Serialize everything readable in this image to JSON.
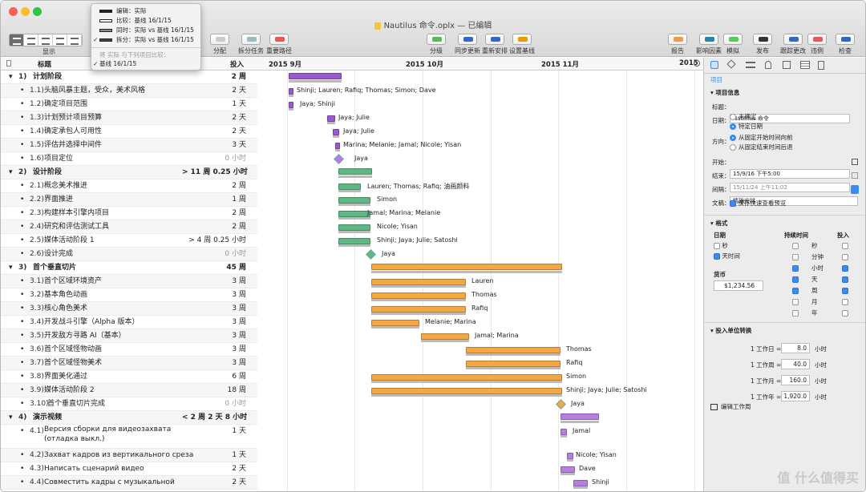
{
  "window": {
    "title": "Nautilus 命令.oplx — 已编辑",
    "title_prefix": "",
    "colors": {
      "close": "#fc5f57",
      "min": "#fdbc2e",
      "max": "#28c840"
    }
  },
  "toolbar": {
    "left_labels": [
      "显示"
    ],
    "items": [
      {
        "label": "分配",
        "icon": "person-icon"
      },
      {
        "label": "拆分任务",
        "icon": "split-icon"
      },
      {
        "label": "重要路径",
        "icon": "path-icon"
      },
      {
        "label": "分级",
        "icon": "level-icon"
      },
      {
        "label": "同步更新",
        "icon": "sync-icon"
      },
      {
        "label": "重新安排",
        "icon": "reschedule-icon"
      },
      {
        "label": "设置基线",
        "icon": "camera-icon"
      },
      {
        "label": "报告",
        "icon": "report-icon"
      },
      {
        "label": "影响因素",
        "icon": "influence-icon"
      },
      {
        "label": "模拟",
        "icon": "simulate-icon"
      },
      {
        "label": "发布",
        "icon": "cloud-icon"
      },
      {
        "label": "跟踪更改",
        "icon": "track-icon"
      },
      {
        "label": "违例",
        "icon": "violation-icon"
      },
      {
        "label": "检查",
        "icon": "inspect-icon"
      }
    ]
  },
  "popup": {
    "items": [
      "编辑：实际",
      "比较：基线 16/1/15",
      "同时：实际 vs 基线 16/1/15",
      "拆分：实际 vs 基线 16/1/15"
    ],
    "selected": 3,
    "section": "将 实际 与下列项目比较：",
    "baseline": "基线 16/1/15"
  },
  "columns": {
    "title": "标题",
    "effort": "投入"
  },
  "gantt_months": [
    "2015 9月",
    "2015 10月",
    "2015 11月",
    "2015"
  ],
  "rows": [
    {
      "num": "1)",
      "title": "计划阶段",
      "dur": "2 周",
      "group": true,
      "res": ""
    },
    {
      "num": "1.1)",
      "title": "头脑风暴主题，受众，美术风格",
      "dur": "2 天",
      "res": "Shinji; Lauren; Rafiq; Thomas; Simon; Dave"
    },
    {
      "num": "1.2)",
      "title": "确定项目范围",
      "dur": "1 天",
      "res": "Jaya; Shinji"
    },
    {
      "num": "1.3)",
      "title": "计划预计项目预算",
      "dur": "2 天",
      "res": "Jaya; Julie"
    },
    {
      "num": "1.4)",
      "title": "确定承包人可用性",
      "dur": "2 天",
      "res": "Jaya; Julie"
    },
    {
      "num": "1.5)",
      "title": "评估并选择中间件",
      "dur": "3 天",
      "res": "Marina; Melanie; Jamal; Nicole; Yisan"
    },
    {
      "num": "1.6)",
      "title": "项目定位",
      "dur": "0 小时",
      "res": "Jaya"
    },
    {
      "num": "2)",
      "title": "设计阶段",
      "dur": "> 11 周 0.25 小时",
      "group": true,
      "res": ""
    },
    {
      "num": "2.1)",
      "title": "概念美术推进",
      "dur": "2 周",
      "res": "Lauren; Thomas; Rafiq; 油画颜料"
    },
    {
      "num": "2.2)",
      "title": "界面推进",
      "dur": "1 周",
      "res": "Simon"
    },
    {
      "num": "2.3)",
      "title": "构建样本引擎内项目",
      "dur": "2 周",
      "res": "Jamal; Marina; Melanie"
    },
    {
      "num": "2.4)",
      "title": "研究和评估测试工具",
      "dur": "2 周",
      "res": "Nicole; Yisan"
    },
    {
      "num": "2.5)",
      "title": "媒体活动阶段 1",
      "dur": "> 4 周 0.25 小时",
      "res": "Shinji; Jaya; Julie; Satoshi"
    },
    {
      "num": "2.6)",
      "title": "设计完成",
      "dur": "0 小时",
      "res": "Jaya"
    },
    {
      "num": "3)",
      "title": "首个垂直切片",
      "dur": "45 周",
      "group": true,
      "res": ""
    },
    {
      "num": "3.1)",
      "title": "首个区域环境资产",
      "dur": "3 周",
      "res": "Lauren"
    },
    {
      "num": "3.2)",
      "title": "基本角色动画",
      "dur": "3 周",
      "res": "Thomas"
    },
    {
      "num": "3.3)",
      "title": "核心角色美术",
      "dur": "3 周",
      "res": "Rafiq"
    },
    {
      "num": "3.4)",
      "title": "开发战斗引擎（Alpha 版本）",
      "dur": "3 周",
      "res": "Melanie; Marina"
    },
    {
      "num": "3.5)",
      "title": "开发敌方寻路 AI（基本）",
      "dur": "3 周",
      "res": "Jamal; Marina"
    },
    {
      "num": "3.6)",
      "title": "首个区域怪物动画",
      "dur": "3 周",
      "res": "Thomas"
    },
    {
      "num": "3.7)",
      "title": "首个区域怪物美术",
      "dur": "3 周",
      "res": "Rafiq"
    },
    {
      "num": "3.8)",
      "title": "界面美化通过",
      "dur": "6 周",
      "res": "Simon"
    },
    {
      "num": "3.9)",
      "title": "媒体活动阶段 2",
      "dur": "18 周",
      "res": "Shinji; Jaya; Julie; Satoshi"
    },
    {
      "num": "3.10)",
      "title": "首个垂直切片完成",
      "dur": "0 小时",
      "res": "Jaya"
    },
    {
      "num": "4)",
      "title": "演示视频",
      "dur": "< 2 周 2 天 8 小时",
      "group": true,
      "res": ""
    },
    {
      "num": "4.1)",
      "title": "Версия сборки для видеозахвата (отладка выкл.)",
      "dur": "1 天",
      "res": "Jamal"
    },
    {
      "num": "4.2)",
      "title": "Захват кадров из вертикального среза",
      "dur": "1 天",
      "res": "Nicole; Yisan"
    },
    {
      "num": "4.3)",
      "title": "Написать сценарий видео",
      "dur": "2 天",
      "res": "Dave"
    },
    {
      "num": "4.4)",
      "title": "Совместить кадры с музыкальной",
      "dur": "2 天",
      "res": "Shinji"
    }
  ],
  "sidebar": {
    "tab_label": "项目",
    "info_title": "项目信息",
    "title_label": "标题：",
    "title_value": "Nautilus 命令",
    "date_label": "日期：",
    "date_opt1": "未确定",
    "date_opt2": "特定日期",
    "dir_label": "方向：",
    "dir_opt1": "从固定开始时间向前",
    "dir_opt2": "从固定结束时间后退",
    "start_label": "开始：",
    "start_value": "15/9/16 下午5:00",
    "end_label": "结束：",
    "end_value": "15/11/24 上午11:02",
    "gran_label": "间隔：",
    "gran_value": "精确安排",
    "doc_label": "文稿：",
    "doc_value": "保存快速查看预览",
    "format_title": "格式",
    "date_col": "日期",
    "dur_col": "持续时间",
    "effort_col": "投入",
    "date_opts": [
      "秒",
      "天时间"
    ],
    "units": [
      "秒",
      "分钟",
      "小时",
      "天",
      "周",
      "月",
      "年"
    ],
    "currency_label": "货币",
    "currency_value": "$1,234.56",
    "conv_title": "投入单位转换",
    "conv": [
      {
        "label": "1 工作日 =",
        "value": "8.0",
        "unit": "小时"
      },
      {
        "label": "1 工作周 =",
        "value": "40.0",
        "unit": "小时"
      },
      {
        "label": "1 工作月 =",
        "value": "160.0",
        "unit": "小时"
      },
      {
        "label": "1 工作年 =",
        "value": "1,920.0",
        "unit": "小时"
      }
    ],
    "edit_cal": "编辑工作周"
  },
  "watermark": "值 什么值得买"
}
